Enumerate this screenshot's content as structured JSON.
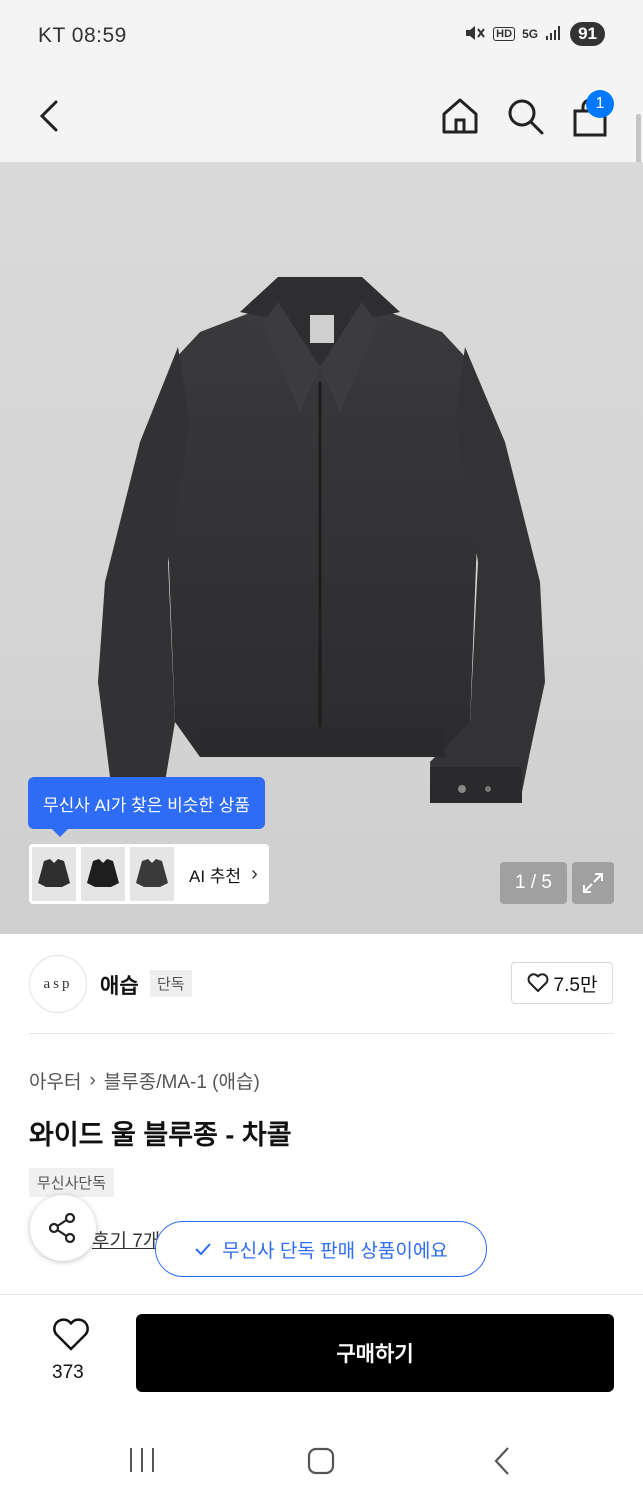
{
  "status_bar": {
    "time": "KT 08:59",
    "network": "5G",
    "hd": "HD",
    "battery": "91"
  },
  "header": {
    "cart_count": "1",
    "icons": [
      "back-icon",
      "home-icon",
      "search-icon",
      "shopping-bag-icon"
    ]
  },
  "gallery": {
    "ai_tooltip": "무신사 AI가 찾은 비슷한 상품",
    "ai_recommend_label": "AI 추천",
    "page_counter": "1 / 5"
  },
  "brand": {
    "logo_text": "asp",
    "name": "애습",
    "tag": "단독",
    "likes": "7.5만"
  },
  "product": {
    "breadcrumb": [
      "아우터",
      "블루종/MA-1 (애습)"
    ],
    "title": "와이드 울 블루종 - 차콜",
    "exclusive_tag": "무신사단독",
    "review_text": "후기 7개",
    "toast": "무신사 단독 판매 상품이에요"
  },
  "bottom_bar": {
    "wish_count": "373",
    "buy_label": "구매하기"
  },
  "colors": {
    "accent_blue": "#2f6cf6",
    "cart_badge": "#0078ff",
    "buy_button": "#000000"
  }
}
